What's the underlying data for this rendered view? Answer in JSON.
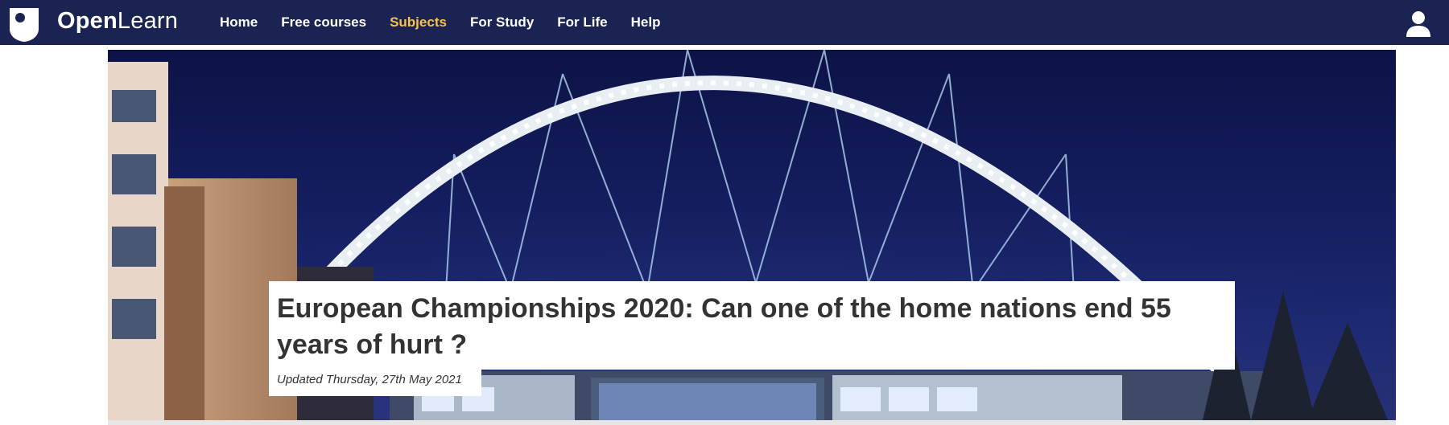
{
  "header": {
    "logo_icon": "open-university-shield-icon",
    "brand": {
      "part1": "Open",
      "part2": "Learn"
    },
    "nav": [
      {
        "label": "Home",
        "active": false
      },
      {
        "label": "Free courses",
        "active": false
      },
      {
        "label": "Subjects",
        "active": true
      },
      {
        "label": "For Study",
        "active": false
      },
      {
        "label": "For Life",
        "active": false
      },
      {
        "label": "Help",
        "active": false
      }
    ],
    "user_icon": "user-icon"
  },
  "hero": {
    "image": "Wembley Stadium arch illuminated at night",
    "title": "European Championships 2020: Can one of the home nations end 55 years of hurt ?",
    "date": "Updated Thursday, 27th May 2021"
  },
  "colors": {
    "header_bg": "#1b2352",
    "active_nav": "#f8c348",
    "title_text": "#333333"
  }
}
